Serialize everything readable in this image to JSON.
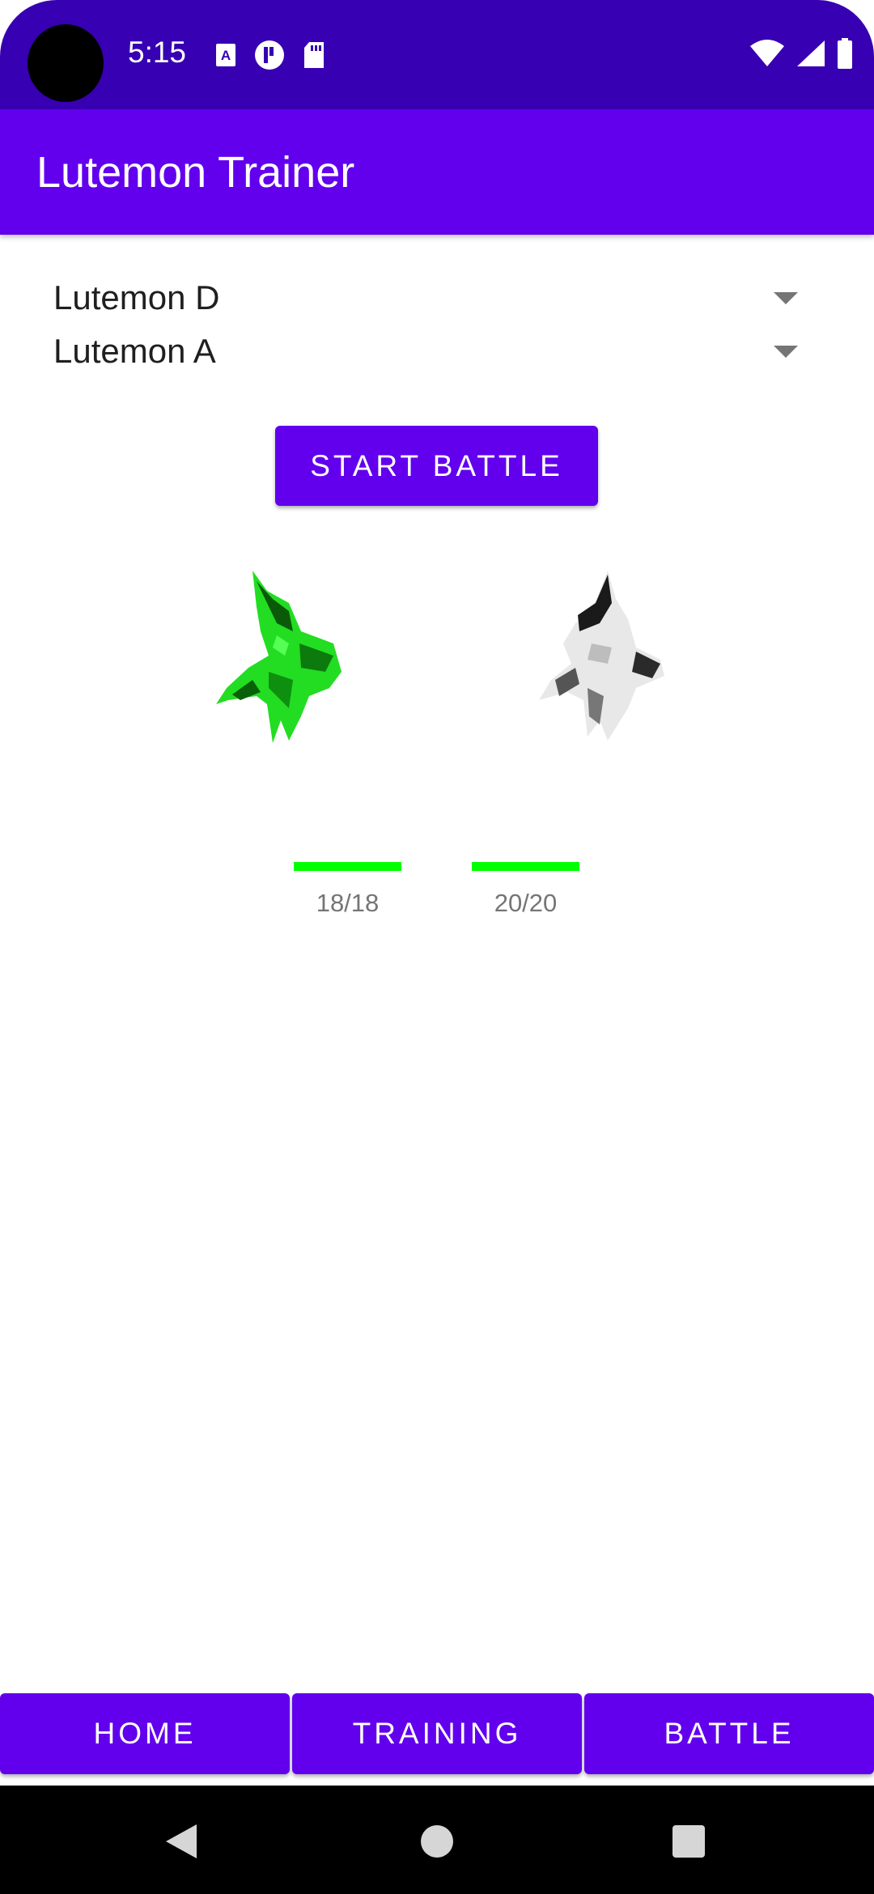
{
  "status_bar": {
    "time": "5:15",
    "left_icons": [
      "text-a-icon",
      "p-circle-icon",
      "sd-card-icon"
    ],
    "right_icons": [
      "wifi-icon",
      "signal-icon",
      "battery-icon"
    ]
  },
  "app_bar": {
    "title": "Lutemon Trainer"
  },
  "spinners": [
    {
      "selected": "Lutemon D"
    },
    {
      "selected": "Lutemon A"
    }
  ],
  "start_button": {
    "label": "START BATTLE"
  },
  "fighters": [
    {
      "sprite": "green-lutemon-sprite",
      "hp_text": "18/18",
      "hp_current": 18,
      "hp_max": 18,
      "hp_color": "#00ff00"
    },
    {
      "sprite": "white-lutemon-sprite",
      "hp_text": "20/20",
      "hp_current": 20,
      "hp_max": 20,
      "hp_color": "#00ff00"
    }
  ],
  "bottom_nav": {
    "home": "HOME",
    "training": "TRAINING",
    "battle": "BATTLE"
  },
  "colors": {
    "primary": "#6200ee",
    "primary_dark": "#3700b3",
    "hp_green": "#00ff00"
  }
}
